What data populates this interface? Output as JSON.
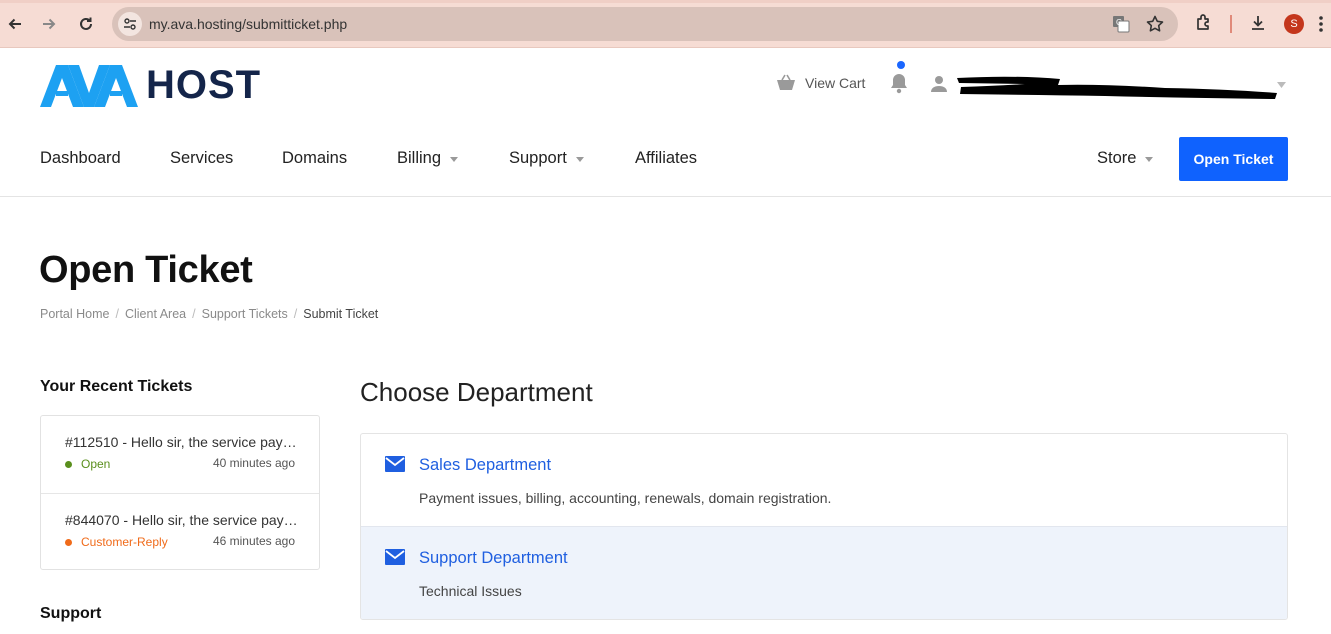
{
  "browser": {
    "url": "my.ava.hosting/submitticket.php",
    "profile_initial": "S"
  },
  "header": {
    "logo_text_left": "AVA",
    "logo_text_right": "HOST",
    "view_cart": "View Cart",
    "open_ticket_button": "Open Ticket"
  },
  "nav": {
    "items": [
      "Dashboard",
      "Services",
      "Domains",
      "Billing",
      "Support",
      "Affiliates"
    ],
    "store": "Store"
  },
  "page": {
    "title": "Open Ticket",
    "breadcrumb": [
      "Portal Home",
      "Client Area",
      "Support Tickets",
      "Submit Ticket"
    ]
  },
  "sidebar": {
    "recent_title": "Your Recent Tickets",
    "tickets": [
      {
        "title": "#112510 - Hello sir, the service pay…",
        "status": "Open",
        "status_color": "#5a8f1d",
        "time": "40 minutes ago"
      },
      {
        "title": "#844070 - Hello sir, the service pay…",
        "status": "Customer-Reply",
        "status_color": "#f06b1a",
        "time": "46 minutes ago"
      }
    ],
    "support_title": "Support"
  },
  "main": {
    "choose_title": "Choose Department",
    "departments": [
      {
        "name": "Sales Department",
        "description": "Payment issues, billing, accounting, renewals, domain registration."
      },
      {
        "name": "Support Department",
        "description": "Technical Issues"
      }
    ]
  },
  "colors": {
    "brand_blue": "#0f62fe",
    "logo_blue": "#1da1f2",
    "logo_navy": "#14254a",
    "link_blue": "#1f5fe0"
  }
}
